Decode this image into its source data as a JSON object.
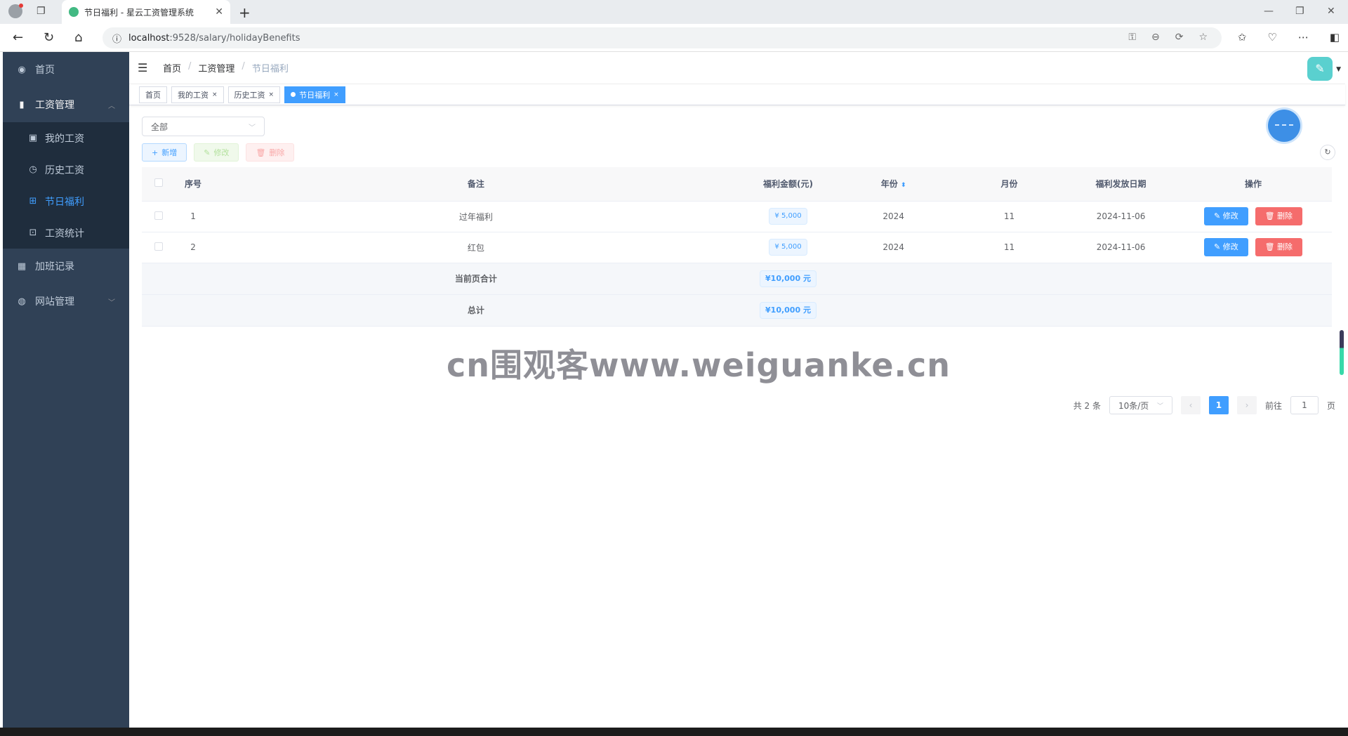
{
  "browser": {
    "tab_title": "节日福利 - 星云工资管理系统",
    "url_host": "localhost",
    "url_path": ":9528/salary/holidayBenefits"
  },
  "sidebar": {
    "items": [
      {
        "label": "首页",
        "icon": "dashboard-icon"
      },
      {
        "label": "工资管理",
        "icon": "salary-icon"
      },
      {
        "label": "加班记录",
        "icon": "calendar-icon"
      },
      {
        "label": "网站管理",
        "icon": "globe-icon"
      }
    ],
    "sub_items": [
      {
        "label": "我的工资",
        "icon": "money-icon"
      },
      {
        "label": "历史工资",
        "icon": "clock-icon"
      },
      {
        "label": "节日福利",
        "icon": "gift-icon"
      },
      {
        "label": "工资统计",
        "icon": "chart-icon"
      }
    ]
  },
  "breadcrumb": [
    "首页",
    "工资管理",
    "节日福利"
  ],
  "tags": [
    "首页",
    "我的工资",
    "历史工资",
    "节日福利"
  ],
  "filter": {
    "selected": "全部"
  },
  "toolbar": {
    "add": "新增",
    "edit": "修改",
    "delete": "删除"
  },
  "table": {
    "headers": [
      "序号",
      "备注",
      "福利金额(元)",
      "年份",
      "月份",
      "福利发放日期",
      "操作"
    ],
    "rows": [
      {
        "no": "1",
        "remark": "过年福利",
        "amount": "¥ 5,000",
        "year": "2024",
        "month": "11",
        "date": "2024-11-06"
      },
      {
        "no": "2",
        "remark": "红包",
        "amount": "¥ 5,000",
        "year": "2024",
        "month": "11",
        "date": "2024-11-06"
      }
    ],
    "op_edit": "修改",
    "op_delete": "删除",
    "page_sum_label": "当前页合计",
    "page_sum": "¥10,000 元",
    "total_label": "总计",
    "total": "¥10,000 元"
  },
  "pager": {
    "total": "共 2 条",
    "size": "10条/页",
    "current": "1",
    "goto_label": "前往",
    "goto_value": "1",
    "page_suffix": "页"
  },
  "watermark": "cn围观客www.weiguanke.cn"
}
